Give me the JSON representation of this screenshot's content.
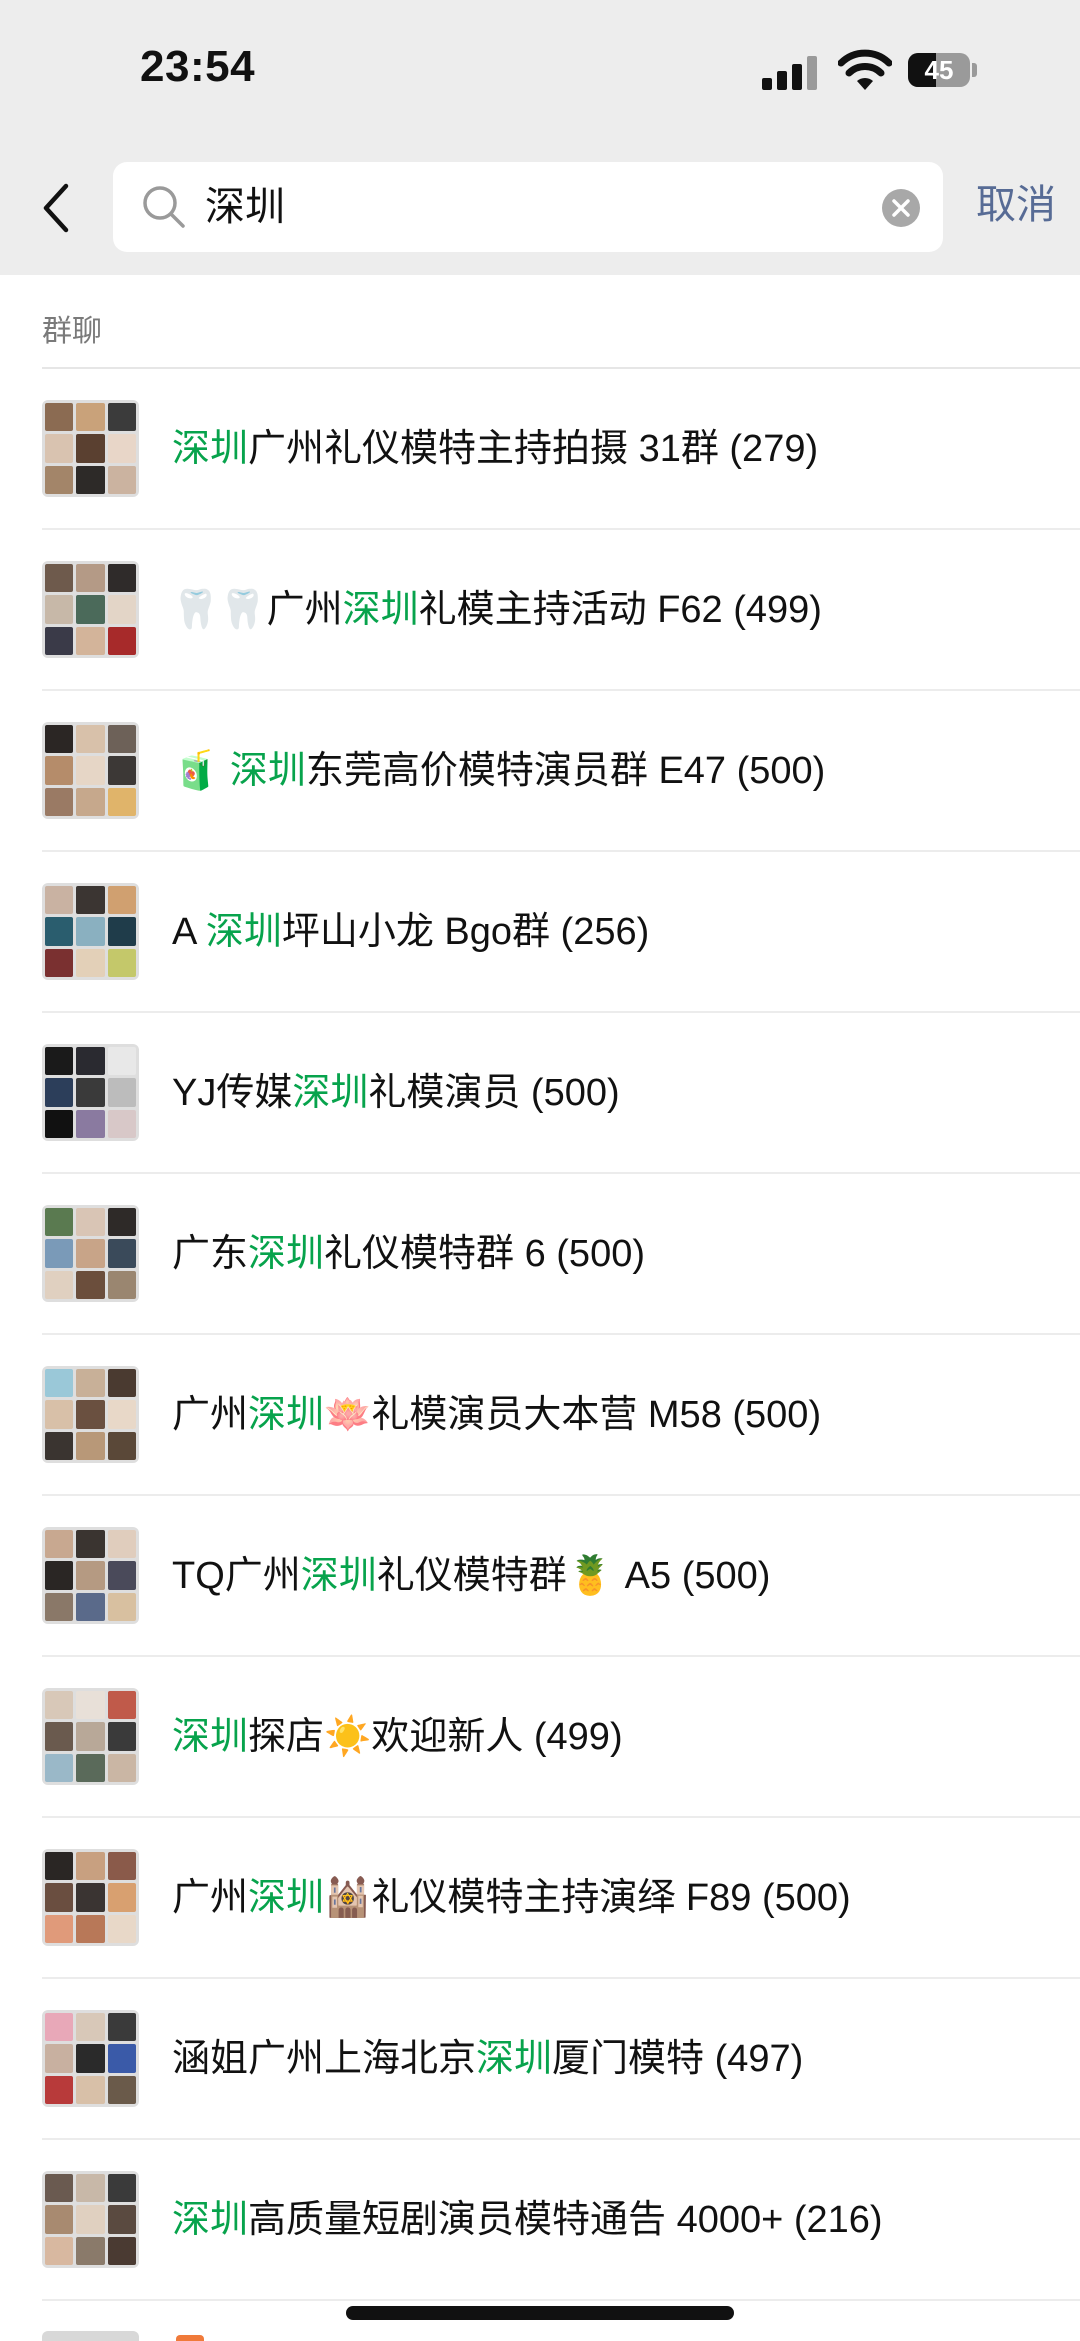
{
  "status": {
    "time": "23:54",
    "battery_level": "45",
    "battery_fraction": 0.45
  },
  "search": {
    "query": "深圳",
    "cancel_label": "取消"
  },
  "section": {
    "label": "群聊"
  },
  "results": [
    {
      "segments": [
        {
          "t": "深圳",
          "hl": true
        },
        {
          "t": "广州礼仪模特主持拍摄 31群 (279)",
          "hl": false
        }
      ],
      "avatar_colors": [
        "#8b6b52",
        "#c9a27a",
        "#3b3b3b",
        "#d9c3b0",
        "#5a4030",
        "#e8d6c8",
        "#a38569",
        "#2d2a28",
        "#cbb3a0"
      ]
    },
    {
      "segments": [
        {
          "t": "🦷🦷广州",
          "hl": false
        },
        {
          "t": "深圳",
          "hl": true
        },
        {
          "t": "礼模主持活动 F62 (499)",
          "hl": false
        }
      ],
      "avatar_colors": [
        "#6e5a4c",
        "#b49a86",
        "#2f2b2a",
        "#c7b8a8",
        "#4b6a5a",
        "#e3d5c7",
        "#3a3a48",
        "#d3b49a",
        "#a72a2a"
      ]
    },
    {
      "segments": [
        {
          "t": "🧃 ",
          "hl": false
        },
        {
          "t": "深圳",
          "hl": true
        },
        {
          "t": "东莞高价模特演员群 E47 (500)",
          "hl": false
        }
      ],
      "avatar_colors": [
        "#2b2624",
        "#d8c1aa",
        "#6d6158",
        "#b58c6a",
        "#e6d6c6",
        "#3c3836",
        "#9a7a64",
        "#c6a88c",
        "#e0b46a"
      ]
    },
    {
      "segments": [
        {
          "t": "A ",
          "hl": false
        },
        {
          "t": "深圳",
          "hl": true
        },
        {
          "t": "坪山小龙 Bgo群 (256)",
          "hl": false
        }
      ],
      "avatar_colors": [
        "#c9b2a2",
        "#3b3532",
        "#d0a070",
        "#2a5d6e",
        "#8ab0c0",
        "#1f3c4a",
        "#7a3030",
        "#e3d0b8",
        "#c4c86a"
      ]
    },
    {
      "segments": [
        {
          "t": "YJ传媒",
          "hl": false
        },
        {
          "t": "深圳",
          "hl": true
        },
        {
          "t": "礼模演员 (500)",
          "hl": false
        }
      ],
      "avatar_colors": [
        "#1a1a1a",
        "#2a2a30",
        "#e8e8e8",
        "#2c3e5a",
        "#3a3a3a",
        "#bcbcbc",
        "#111111",
        "#8a7aa0",
        "#d8c8c8"
      ]
    },
    {
      "segments": [
        {
          "t": "广东",
          "hl": false
        },
        {
          "t": "深圳",
          "hl": true
        },
        {
          "t": "礼仪模特群 6 (500)",
          "hl": false
        }
      ],
      "avatar_colors": [
        "#5a7a50",
        "#d9c5b5",
        "#2e2a28",
        "#7a9ab8",
        "#c8a488",
        "#3a4a5a",
        "#e0d0c0",
        "#6b4e3c",
        "#9a8670"
      ]
    },
    {
      "segments": [
        {
          "t": "广州",
          "hl": false
        },
        {
          "t": "深圳",
          "hl": true
        },
        {
          "t": "🪷礼模演员大本营 M58 (500)",
          "hl": false
        }
      ],
      "avatar_colors": [
        "#9ac8d8",
        "#c8b098",
        "#4a3a30",
        "#d8c0a8",
        "#6a5040",
        "#e8d8c8",
        "#3a3430",
        "#b89878",
        "#5a4838"
      ]
    },
    {
      "segments": [
        {
          "t": "TQ广州",
          "hl": false
        },
        {
          "t": "深圳",
          "hl": true
        },
        {
          "t": "礼仪模特群🍍 A5 (500)",
          "hl": false
        }
      ],
      "avatar_colors": [
        "#c8a890",
        "#3a3430",
        "#e0cdbd",
        "#2a2624",
        "#b59a82",
        "#4a4a5a",
        "#8a7868",
        "#5a6a8a",
        "#d8c0a0"
      ]
    },
    {
      "segments": [
        {
          "t": "深圳",
          "hl": true
        },
        {
          "t": "探店☀️欢迎新人 (499)",
          "hl": false
        }
      ],
      "avatar_colors": [
        "#d8c8b8",
        "#e8e0d8",
        "#c05a4a",
        "#6a5a4e",
        "#b8a898",
        "#3a3a3a",
        "#9ab8c8",
        "#5a6a5a",
        "#cab6a4"
      ]
    },
    {
      "segments": [
        {
          "t": "广州",
          "hl": false
        },
        {
          "t": "深圳",
          "hl": true
        },
        {
          "t": "🕍礼仪模特主持演绎 F89 (500)",
          "hl": false
        }
      ],
      "avatar_colors": [
        "#2a2624",
        "#c8a080",
        "#8a5a4a",
        "#6a4e40",
        "#3a3432",
        "#d8a070",
        "#e09a7a",
        "#b87858",
        "#e8d8c8"
      ]
    },
    {
      "segments": [
        {
          "t": "涵姐广州上海北京",
          "hl": false
        },
        {
          "t": "深圳",
          "hl": true
        },
        {
          "t": "厦门模特 (497)",
          "hl": false
        }
      ],
      "avatar_colors": [
        "#e8a8b8",
        "#d8c8b8",
        "#3a3a3a",
        "#c8b0a0",
        "#2a2a2a",
        "#3a5aa8",
        "#b83a3a",
        "#d8c0a8",
        "#6a5a4a"
      ]
    },
    {
      "segments": [
        {
          "t": "深圳",
          "hl": true
        },
        {
          "t": "高质量短剧演员模特通告 4000+ (216)",
          "hl": false
        }
      ],
      "avatar_colors": [
        "#6a5a50",
        "#c8b8a8",
        "#3a3a3a",
        "#a88a70",
        "#e0d0c0",
        "#5a4a40",
        "#d8b8a0",
        "#8a7a6a",
        "#4a3a32"
      ]
    }
  ]
}
